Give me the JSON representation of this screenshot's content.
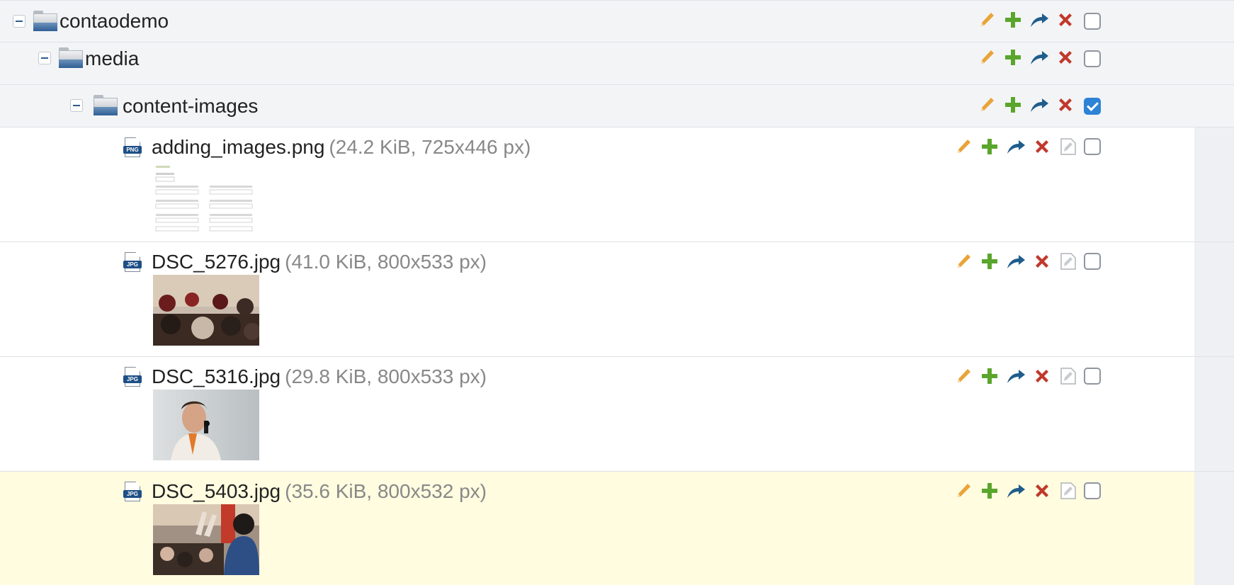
{
  "folders": [
    {
      "name": "contaodemo",
      "checked": false
    },
    {
      "name": "media",
      "checked": false
    },
    {
      "name": "content-images",
      "checked": true
    }
  ],
  "files": [
    {
      "name": "adding_images.png",
      "meta": "(24.2 KiB, 725x446 px)",
      "type": "PNG",
      "thumb": "screenshot-form",
      "checked": false
    },
    {
      "name": "DSC_5276.jpg",
      "meta": "(41.0 KiB, 800x533 px)",
      "type": "JPG",
      "thumb": "audience-photo",
      "checked": false
    },
    {
      "name": "DSC_5316.jpg",
      "meta": "(29.8 KiB, 800x533 px)",
      "type": "JPG",
      "thumb": "speaker-microphone-photo",
      "checked": false
    },
    {
      "name": "DSC_5403.jpg",
      "meta": "(35.6 KiB, 800x532 px)",
      "type": "JPG",
      "thumb": "presenter-audience-photo",
      "checked": false
    }
  ],
  "icons": {
    "edit": "pencil-icon",
    "add": "plus-icon",
    "move": "move-arrow-icon",
    "delete": "delete-x-icon",
    "header": "edit-header-icon",
    "toggle": "collapse-icon",
    "folder": "folder-icon"
  },
  "colors": {
    "pencil": "#e9a438",
    "plus": "#5aa62c",
    "move": "#1f5d8c",
    "delete": "#c0392b",
    "highlight_row": "#fffce0",
    "checkbox_checked": "#2d83d5"
  }
}
